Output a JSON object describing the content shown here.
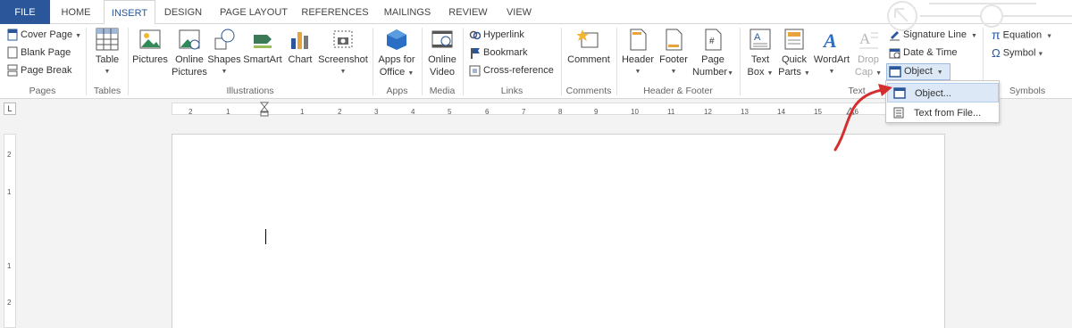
{
  "tabs": {
    "file": "FILE",
    "home": "HOME",
    "insert": "INSERT",
    "design": "DESIGN",
    "page_layout": "PAGE LAYOUT",
    "references": "REFERENCES",
    "mailings": "MAILINGS",
    "review": "REVIEW",
    "view": "VIEW"
  },
  "ribbon": {
    "pages": {
      "cover_page": "Cover Page",
      "blank_page": "Blank Page",
      "page_break": "Page Break",
      "label": "Pages"
    },
    "tables": {
      "table": "Table",
      "label": "Tables"
    },
    "illustrations": {
      "pictures": "Pictures",
      "online_pictures_1": "Online",
      "online_pictures_2": "Pictures",
      "shapes": "Shapes",
      "smartart": "SmartArt",
      "chart": "Chart",
      "screenshot": "Screenshot",
      "label": "Illustrations"
    },
    "apps": {
      "apps_1": "Apps for",
      "apps_2": "Office",
      "label": "Apps"
    },
    "media": {
      "video_1": "Online",
      "video_2": "Video",
      "label": "Media"
    },
    "links": {
      "hyperlink": "Hyperlink",
      "bookmark": "Bookmark",
      "cross_reference": "Cross-reference",
      "label": "Links"
    },
    "comments": {
      "comment": "Comment",
      "label": "Comments"
    },
    "header_footer": {
      "header": "Header",
      "footer": "Footer",
      "page_number_1": "Page",
      "page_number_2": "Number",
      "label": "Header & Footer"
    },
    "text": {
      "text_box_1": "Text",
      "text_box_2": "Box",
      "quick_parts_1": "Quick",
      "quick_parts_2": "Parts",
      "wordart": "WordArt",
      "drop_cap_1": "Drop",
      "drop_cap_2": "Cap",
      "signature_line": "Signature Line",
      "date_time": "Date & Time",
      "object": "Object",
      "label": "Text"
    },
    "symbols": {
      "equation": "Equation",
      "symbol": "Symbol",
      "label": "Symbols"
    }
  },
  "ruler": {
    "ticks": [
      "2",
      "1",
      "1",
      "2",
      "3",
      "4",
      "5",
      "6",
      "7",
      "8",
      "9",
      "10",
      "11",
      "12",
      "13",
      "14",
      "15",
      "16"
    ],
    "vticks": [
      "2",
      "1",
      "1",
      "2"
    ],
    "tab_selector": "L"
  },
  "menu": {
    "object": "Object...",
    "text_from_file": "Text from File..."
  },
  "colors": {
    "accent": "#2b579a",
    "annotation_arrow": "#d32f2f",
    "highlight": "#dce8f6"
  }
}
